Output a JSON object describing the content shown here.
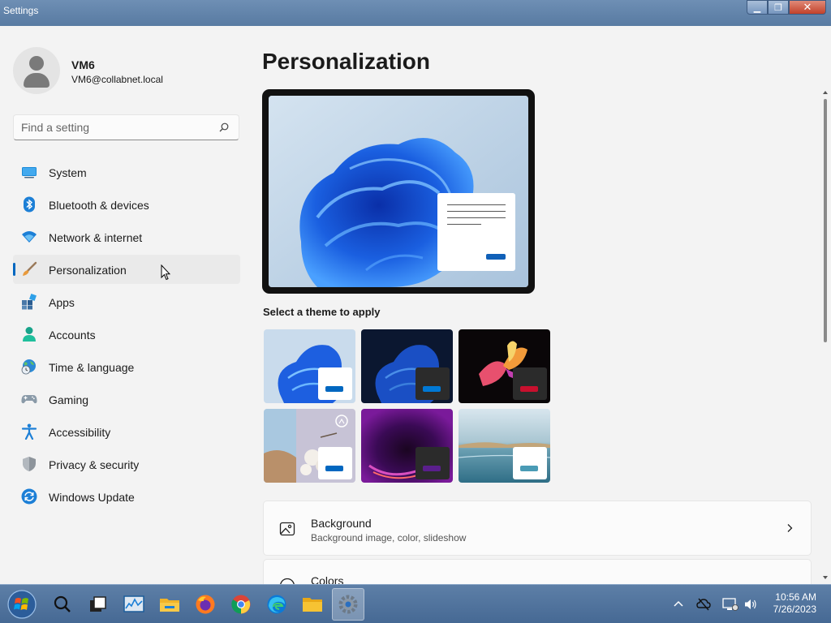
{
  "window": {
    "title": "Settings",
    "min_glyph": "▁",
    "max_glyph": "❐",
    "close_glyph": "✕"
  },
  "user": {
    "name": "VM6",
    "email": "VM6@collabnet.local"
  },
  "search": {
    "placeholder": "Find a setting",
    "icon": "search-icon"
  },
  "nav": {
    "items": [
      {
        "label": "System",
        "icon": "system-icon"
      },
      {
        "label": "Bluetooth & devices",
        "icon": "bluetooth-icon"
      },
      {
        "label": "Network & internet",
        "icon": "wifi-icon"
      },
      {
        "label": "Personalization",
        "icon": "brush-icon",
        "active": true
      },
      {
        "label": "Apps",
        "icon": "apps-icon"
      },
      {
        "label": "Accounts",
        "icon": "person-icon"
      },
      {
        "label": "Time & language",
        "icon": "globe-clock-icon"
      },
      {
        "label": "Gaming",
        "icon": "gamepad-icon"
      },
      {
        "label": "Accessibility",
        "icon": "accessibility-icon"
      },
      {
        "label": "Privacy & security",
        "icon": "shield-icon"
      },
      {
        "label": "Windows Update",
        "icon": "update-icon"
      }
    ]
  },
  "main": {
    "title": "Personalization",
    "themes_label": "Select a theme to apply",
    "themes": [
      {
        "name": "windows-light",
        "accent": "#0067c0"
      },
      {
        "name": "windows-dark",
        "accent": "#0078d4"
      },
      {
        "name": "glow",
        "accent": "#c8102e"
      },
      {
        "name": "captured-motion",
        "accent": "#0067c0"
      },
      {
        "name": "sunrise",
        "accent": "#5a1f8c"
      },
      {
        "name": "flow",
        "accent": "#4a9bb5"
      }
    ],
    "cards": [
      {
        "title": "Background",
        "subtitle": "Background image, color, slideshow",
        "icon": "image-icon"
      },
      {
        "title": "Colors",
        "subtitle": "",
        "icon": "palette-icon"
      }
    ]
  },
  "taskbar": {
    "apps": [
      "start-orb",
      "search",
      "task-view",
      "task-manager",
      "file-explorer",
      "firefox",
      "chrome",
      "edge",
      "folder",
      "settings"
    ],
    "clock": {
      "time": "10:56 AM",
      "date": "7/26/2023"
    }
  },
  "colors": {
    "accent": "#0067c0",
    "taskbar": "#466994",
    "background": "#f3f3f3"
  }
}
